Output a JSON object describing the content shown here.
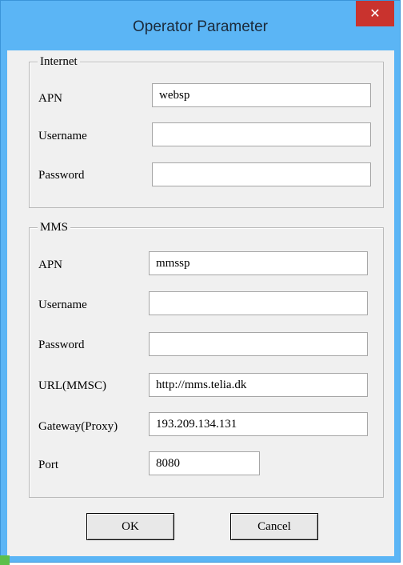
{
  "window": {
    "title": "Operator Parameter",
    "close_glyph": "✕"
  },
  "internet": {
    "legend": "Internet",
    "apn_label": "APN",
    "apn_value": "websp",
    "username_label": "Username",
    "username_value": "",
    "password_label": "Password",
    "password_value": ""
  },
  "mms": {
    "legend": "MMS",
    "apn_label": "APN",
    "apn_value": "mmssp",
    "username_label": "Username",
    "username_value": "",
    "password_label": "Password",
    "password_value": "",
    "url_label": "URL(MMSC)",
    "url_value": "http://mms.telia.dk",
    "gateway_label": "Gateway(Proxy)",
    "gateway_value": "193.209.134.131",
    "port_label": "Port",
    "port_value": "8080"
  },
  "buttons": {
    "ok": "OK",
    "cancel": "Cancel"
  },
  "colors": {
    "titlebar": "#5bb5f5",
    "close": "#c9332e",
    "client": "#f0f0f0"
  }
}
